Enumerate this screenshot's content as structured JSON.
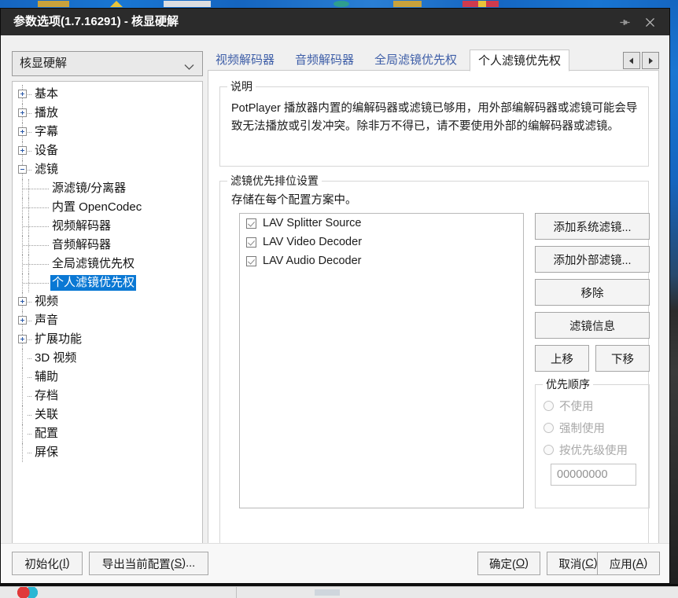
{
  "window": {
    "title": "参数选项(1.7.16291) - 核显硬解",
    "pin_icon": "pin-icon",
    "close_icon": "close-icon"
  },
  "profile": {
    "selected": "核显硬解",
    "chevron_icon": "chevron-down-icon"
  },
  "tree": {
    "items": [
      {
        "label": "基本",
        "indent": 0,
        "toggle": "plus",
        "selected": false
      },
      {
        "label": "播放",
        "indent": 0,
        "toggle": "plus",
        "selected": false
      },
      {
        "label": "字幕",
        "indent": 0,
        "toggle": "plus",
        "selected": false
      },
      {
        "label": "设备",
        "indent": 0,
        "toggle": "plus",
        "selected": false
      },
      {
        "label": "滤镜",
        "indent": 0,
        "toggle": "minus",
        "selected": false
      },
      {
        "label": "源滤镜/分离器",
        "indent": 1,
        "toggle": "none",
        "selected": false
      },
      {
        "label": "内置 OpenCodec",
        "indent": 1,
        "toggle": "none",
        "selected": false
      },
      {
        "label": "视频解码器",
        "indent": 1,
        "toggle": "none",
        "selected": false
      },
      {
        "label": "音频解码器",
        "indent": 1,
        "toggle": "none",
        "selected": false
      },
      {
        "label": "全局滤镜优先权",
        "indent": 1,
        "toggle": "none",
        "selected": false
      },
      {
        "label": "个人滤镜优先权",
        "indent": 1,
        "toggle": "none",
        "selected": true
      },
      {
        "label": "视频",
        "indent": 0,
        "toggle": "plus",
        "selected": false
      },
      {
        "label": "声音",
        "indent": 0,
        "toggle": "plus",
        "selected": false
      },
      {
        "label": "扩展功能",
        "indent": 0,
        "toggle": "plus",
        "selected": false
      },
      {
        "label": "3D 视频",
        "indent": 0,
        "toggle": "none",
        "selected": false
      },
      {
        "label": "辅助",
        "indent": 0,
        "toggle": "none",
        "selected": false
      },
      {
        "label": "存档",
        "indent": 0,
        "toggle": "none",
        "selected": false
      },
      {
        "label": "关联",
        "indent": 0,
        "toggle": "none",
        "selected": false
      },
      {
        "label": "配置",
        "indent": 0,
        "toggle": "none",
        "selected": false
      },
      {
        "label": "屏保",
        "indent": 0,
        "toggle": "none",
        "selected": false
      }
    ]
  },
  "tabs": {
    "items": [
      {
        "label": "视频解码器",
        "active": false
      },
      {
        "label": "音频解码器",
        "active": false
      },
      {
        "label": "全局滤镜优先权",
        "active": false
      },
      {
        "label": "个人滤镜优先权",
        "active": true
      }
    ],
    "prev_icon": "triangle-left-icon",
    "next_icon": "triangle-right-icon"
  },
  "description": {
    "group_title": "说明",
    "text": "PotPlayer 播放器内置的编解码器或滤镜已够用，用外部编解码器或滤镜可能会导致无法播放或引发冲突。除非万不得已，请不要使用外部的编解码器或滤镜。"
  },
  "priority_section": {
    "group_title": "滤镜优先排位设置",
    "subtitle": "存储在每个配置方案中。",
    "filters": [
      {
        "label": "LAV Splitter Source",
        "checked": true
      },
      {
        "label": "LAV Video Decoder",
        "checked": true
      },
      {
        "label": "LAV Audio Decoder",
        "checked": true
      }
    ],
    "buttons": {
      "add_system": "添加系统滤镜...",
      "add_external": "添加外部滤镜...",
      "remove": "移除",
      "filter_info": "滤镜信息",
      "move_up": "上移",
      "move_down": "下移"
    }
  },
  "order_group": {
    "group_title": "优先顺序",
    "options": [
      {
        "label": "不使用",
        "selected": false,
        "disabled": true
      },
      {
        "label": "强制使用",
        "selected": false,
        "disabled": true
      },
      {
        "label": "按优先级使用",
        "selected": false,
        "disabled": true
      }
    ],
    "value": "00000000"
  },
  "footer": {
    "initialize": "初始化(I)",
    "initialize_mnemonic": "I",
    "export": "导出当前配置(S)...",
    "export_mnemonic": "S",
    "ok": "确定(O)",
    "ok_mnemonic": "O",
    "cancel": "取消(C)",
    "cancel_mnemonic": "C",
    "apply": "应用(A)",
    "apply_mnemonic": "A"
  },
  "colors": {
    "titlebar_bg": "#2b2b2b",
    "selection_blue": "#0a78d4",
    "tab_inactive_text": "#3f5fa8",
    "dialog_bg": "#f0f0f0"
  }
}
